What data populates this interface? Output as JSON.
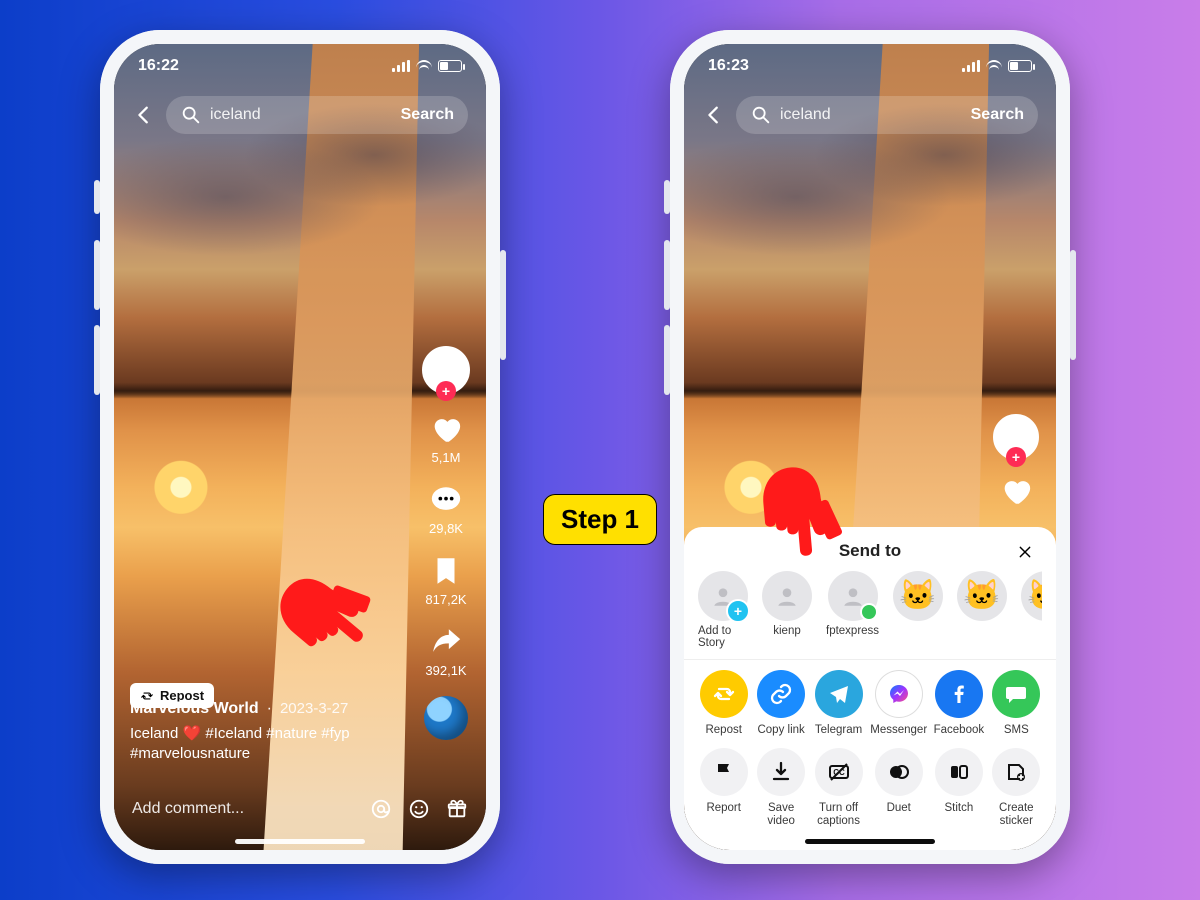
{
  "step_label": "Step 1",
  "left": {
    "status_time": "16:22",
    "search_query": "iceland",
    "search_button": "Search",
    "repost_button": "Repost",
    "author": "Marvelous World",
    "date": "2023-3-27",
    "caption": "Iceland ❤️ #Iceland #nature #fyp #marvelousnature",
    "comment_placeholder": "Add comment...",
    "rail": {
      "likes": "5,1M",
      "comments": "29,8K",
      "saves": "817,2K",
      "shares": "392,1K"
    }
  },
  "right": {
    "status_time": "16:23",
    "search_query": "iceland",
    "search_button": "Search",
    "sheet_title": "Send to",
    "contacts": [
      {
        "label": "Add to Story",
        "kind": "story"
      },
      {
        "label": "kienp",
        "kind": "person"
      },
      {
        "label": "fptexpress",
        "kind": "online"
      },
      {
        "label": "",
        "kind": "cat"
      },
      {
        "label": "",
        "kind": "cat"
      },
      {
        "label": "",
        "kind": "cat"
      }
    ],
    "share_row1": [
      {
        "label": "Repost",
        "color": "yellow",
        "icon": "repost"
      },
      {
        "label": "Copy link",
        "color": "blue",
        "icon": "link"
      },
      {
        "label": "Telegram",
        "color": "tg",
        "icon": "plane"
      },
      {
        "label": "Messenger",
        "color": "msgr",
        "icon": "messenger"
      },
      {
        "label": "Facebook",
        "color": "fb",
        "icon": "facebook"
      },
      {
        "label": "SMS",
        "color": "sms",
        "icon": "sms"
      }
    ],
    "share_row2": [
      {
        "label": "Report",
        "icon": "flag"
      },
      {
        "label": "Save video",
        "icon": "download"
      },
      {
        "label": "Turn off captions",
        "icon": "cc-off"
      },
      {
        "label": "Duet",
        "icon": "duet"
      },
      {
        "label": "Stitch",
        "icon": "stitch"
      },
      {
        "label": "Create sticker",
        "icon": "sticker"
      }
    ]
  }
}
